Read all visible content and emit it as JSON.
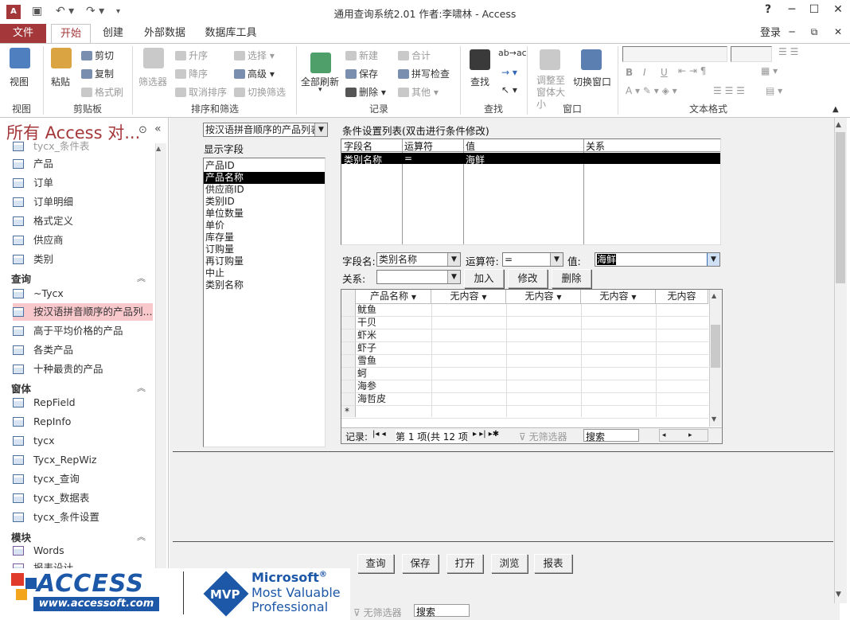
{
  "window": {
    "title": "通用查询系统2.01 作者:李啸林 - Access",
    "app_icon": "A",
    "signin": "登录",
    "help": "?",
    "minimize": "─",
    "restore": "☐",
    "close": "✕"
  },
  "tabs": [
    "文件",
    "开始",
    "创建",
    "外部数据",
    "数据库工具"
  ],
  "ribbon": {
    "view": {
      "view": "视图",
      "group": "视图"
    },
    "clipboard": {
      "paste": "粘贴",
      "cut": "剪切",
      "copy": "复制",
      "format_painter": "格式刷",
      "group": "剪贴板"
    },
    "sort": {
      "filter": "筛选器",
      "asc": "升序",
      "desc": "降序",
      "remove_sort": "取消排序",
      "select": "选择",
      "advanced": "高级",
      "toggle_filter": "切换筛选",
      "group": "排序和筛选"
    },
    "records": {
      "refresh_all": "全部刷新",
      "new": "新建",
      "save": "保存",
      "delete": "删除",
      "totals": "合计",
      "spelling": "拼写检查",
      "more": "其他",
      "group": "记录"
    },
    "find": {
      "find": "查找",
      "group": "查找"
    },
    "window": {
      "size_to_fit": "调整至窗体大小",
      "switch": "切换窗口",
      "group": "窗口"
    },
    "text": {
      "bold": "B",
      "italic": "I",
      "underline": "U",
      "group": "文本格式"
    }
  },
  "nav": {
    "title": "所有 Access 对...",
    "items_top": [
      "tycx_条件表",
      "产品",
      "订单",
      "订单明细",
      "格式定义",
      "供应商",
      "类别"
    ],
    "sec_query": "查询",
    "queries": [
      "~Tycx",
      "按汉语拼音顺序的产品列...",
      "高于平均价格的产品",
      "各类产品",
      "十种最贵的产品"
    ],
    "sec_form": "窗体",
    "forms": [
      "RepField",
      "RepInfo",
      "tycx",
      "Tycx_RepWiz",
      "tycx_查询",
      "tycx_数据表",
      "tycx_条件设置"
    ],
    "sec_module": "模块",
    "modules": [
      "Words",
      "报表设计"
    ]
  },
  "form": {
    "source_combo": "按汉语拼音顺序的产品列表",
    "fields_label": "显示字段",
    "fields": [
      "产品ID",
      "产品名称",
      "供应商ID",
      "类别ID",
      "单位数量",
      "单价",
      "库存量",
      "订购量",
      "再订购量",
      "中止",
      "类别名称"
    ],
    "selected_field": "产品名称",
    "cond_label": "条件设置列表(双击进行条件修改)",
    "cond_headers": [
      "字段名",
      "运算符",
      "值",
      "关系"
    ],
    "cond_row": [
      "类别名称",
      "=",
      "海鲜",
      ""
    ],
    "field_label": "字段名:",
    "field_value": "类别名称",
    "op_label": "运算符:",
    "op_value": "=",
    "val_label": "值:",
    "val_value": "海鲜",
    "rel_label": "关系:",
    "rel_value": "",
    "add": "加入",
    "modify": "修改",
    "delete": "删除",
    "grid_headers": [
      "产品名称",
      "无内容",
      "无内容",
      "无内容",
      "无内容"
    ],
    "grid_rows": [
      "鱿鱼",
      "干贝",
      "虾米",
      "虾子",
      "雪鱼",
      "蚵",
      "海参",
      "海哲皮"
    ],
    "new_row_marker": "*",
    "record_label": "记录:",
    "record_nav": "第 1 项(共 12 项",
    "no_filter": "无筛选器",
    "search": "搜索",
    "bottom_buttons": [
      "查询",
      "保存",
      "打开",
      "浏览",
      "报表"
    ],
    "status_no_filter": "无筛选器",
    "status_search": "搜索"
  },
  "logo": {
    "access": "ACCESS",
    "site": "www.accessoft.com",
    "mvp": "MVP",
    "ms": "Microsoft",
    "mvp1": "Most Valuable",
    "mvp2": "Professional"
  },
  "colors": {
    "accent": "#a4373a",
    "selected_nav": "#f8c8cc"
  }
}
